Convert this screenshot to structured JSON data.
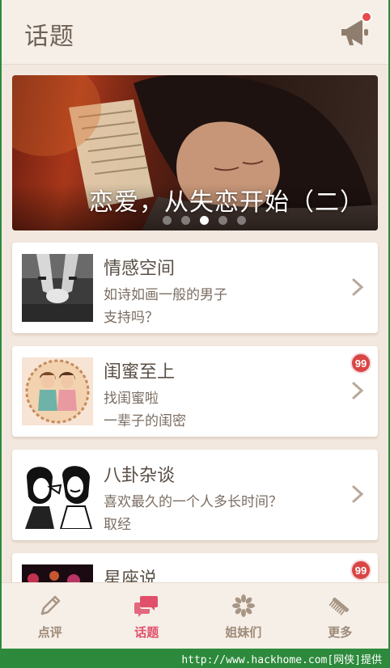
{
  "header": {
    "title": "话题"
  },
  "banner": {
    "caption": "恋爱，从失恋开始（二）",
    "page_count": 5,
    "active_page": 3
  },
  "topics": [
    {
      "title": "情感空间",
      "line1": "如诗如画一般的男子",
      "line2": "支持吗？",
      "badge": "",
      "thumb": "holding-hands-photo"
    },
    {
      "title": "闺蜜至上",
      "line1": "找闺蜜啦",
      "line2": "一辈子的闺密",
      "badge": "99",
      "thumb": "two-girls-illustration"
    },
    {
      "title": "八卦杂谈",
      "line1": "喜欢最久的一个人多长时间？",
      "line2": "取经",
      "badge": "",
      "thumb": "gossip-women-comic"
    },
    {
      "title": "星座说",
      "line1": "",
      "line2": "",
      "badge": "99",
      "thumb": "bokeh-lights-photo"
    }
  ],
  "tabs": [
    {
      "label": "点评",
      "icon": "pencil-icon",
      "active": false
    },
    {
      "label": "话题",
      "icon": "chat-bubbles-icon",
      "active": true
    },
    {
      "label": "姐妹们",
      "icon": "flower-icon",
      "active": false
    },
    {
      "label": "更多",
      "icon": "comb-icon",
      "active": false
    }
  ],
  "colors": {
    "background": "#f2e8df",
    "accent": "#e0506a",
    "badge": "#d94545",
    "tab_inactive": "#9d8a78"
  },
  "watermark": "http://www.hackhome.com[网侠]提供"
}
